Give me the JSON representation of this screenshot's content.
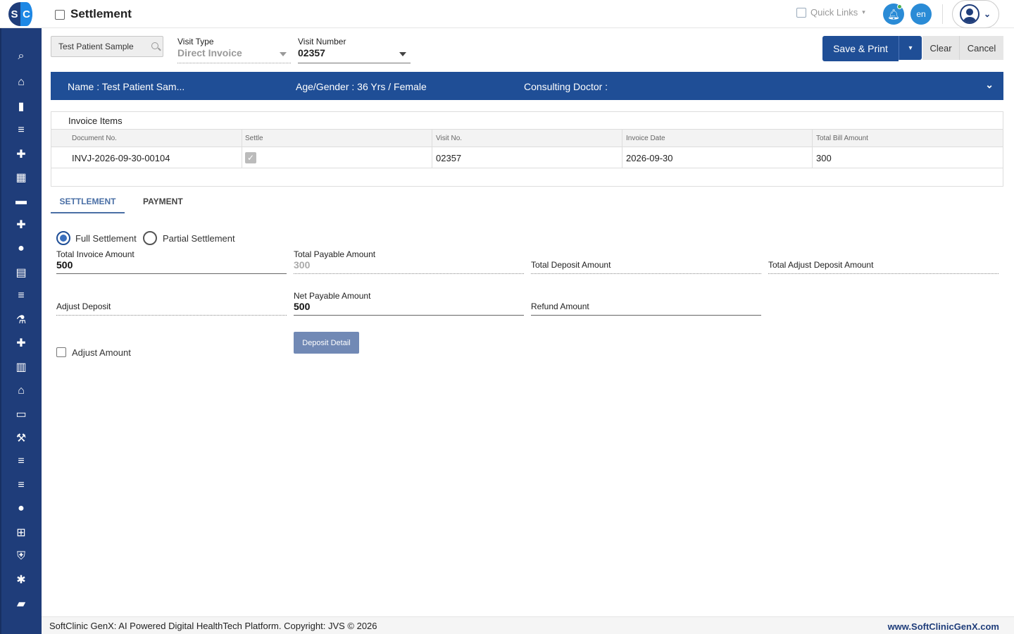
{
  "app": {
    "logo_text_left": "S",
    "logo_text_right": "C",
    "page_title": "Settlement",
    "quick_links": "Quick Links",
    "language": "en"
  },
  "sidebar": {
    "items": [
      {
        "name": "search-icon",
        "glyph": "⌕"
      },
      {
        "name": "home-icon",
        "glyph": "⌂"
      },
      {
        "name": "bar-chart-icon",
        "glyph": "▮"
      },
      {
        "name": "menu-icon",
        "glyph": "≡"
      },
      {
        "name": "medical-kit-icon",
        "glyph": "✚"
      },
      {
        "name": "calendar-icon",
        "glyph": "▦"
      },
      {
        "name": "bed-icon",
        "glyph": "▬"
      },
      {
        "name": "hospital-plus-icon",
        "glyph": "✚"
      },
      {
        "name": "person-icon",
        "glyph": "●"
      },
      {
        "name": "receipt-icon",
        "glyph": "▤"
      },
      {
        "name": "list-icon",
        "glyph": "≡"
      },
      {
        "name": "lab-icon",
        "glyph": "⚗"
      },
      {
        "name": "pharmacy-icon",
        "glyph": "✚"
      },
      {
        "name": "book-icon",
        "glyph": "▥"
      },
      {
        "name": "store-icon",
        "glyph": "⌂"
      },
      {
        "name": "devices-icon",
        "glyph": "▭"
      },
      {
        "name": "wrench-icon",
        "glyph": "⚒"
      },
      {
        "name": "menu-2-icon",
        "glyph": "≡"
      },
      {
        "name": "menu-3-icon",
        "glyph": "≡"
      },
      {
        "name": "blood-drop-icon",
        "glyph": "●"
      },
      {
        "name": "add-box-icon",
        "glyph": "⊞"
      },
      {
        "name": "shield-icon",
        "glyph": "⛨"
      },
      {
        "name": "network-icon",
        "glyph": "✱"
      },
      {
        "name": "folder-icon",
        "glyph": "▰"
      }
    ]
  },
  "toolbar": {
    "patient_search_value": "Test Patient Sample",
    "visit_type_label": "Visit Type",
    "visit_type_value": "Direct Invoice",
    "visit_number_label": "Visit Number",
    "visit_number_value": "02357",
    "save_print": "Save & Print",
    "split_caret": "▾",
    "clear": "Clear",
    "cancel": "Cancel"
  },
  "patient_banner": {
    "name": "Name :  Test Patient Sam...",
    "age_gender": "Age/Gender :  36 Yrs / Female",
    "consulting_doctor": "Consulting Doctor :"
  },
  "invoice_items": {
    "title": "Invoice Items",
    "columns": [
      "Document No.",
      "Settle",
      "Visit No.",
      "Invoice Date",
      "Total Bill Amount"
    ],
    "rows": [
      {
        "document_no": "INVJ-2026-09-30-00104",
        "settle": true,
        "visit_no": "02357",
        "invoice_date": "2026-09-30",
        "total_bill_amount": "300"
      }
    ]
  },
  "tabs": [
    {
      "label": "SETTLEMENT",
      "active": true
    },
    {
      "label": "PAYMENT",
      "active": false
    }
  ],
  "settlement": {
    "full_settlement": "Full Settlement",
    "partial_settlement": "Partial Settlement",
    "selected": "Full Settlement",
    "total_invoice_amount_label": "Total Invoice Amount",
    "total_invoice_amount": "500",
    "total_payable_amount_label": "Total Payable Amount",
    "total_payable_amount": "300",
    "total_deposit_amount_label": "Total Deposit Amount",
    "total_adjust_deposit_amount_label": "Total Adjust Deposit Amount",
    "adjust_deposit_label": "Adjust Deposit",
    "net_payable_amount_label": "Net Payable Amount",
    "net_payable_amount": "500",
    "refund_amount_label": "Refund Amount",
    "deposit_detail_button": "Deposit Detail",
    "adjust_amount_label": "Adjust Amount",
    "adjust_amount_checked": false
  },
  "footer": {
    "copyright": "SoftClinic GenX: AI Powered Digital HealthTech Platform. Copyright: JVS © 2026",
    "website": "www.SoftClinicGenX.com"
  },
  "colors": {
    "primary": "#1f4e96",
    "sidebar": "#1f3d7a",
    "accent": "#2a8bd6"
  }
}
